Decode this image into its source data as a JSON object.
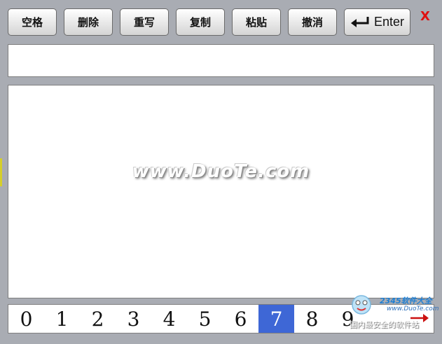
{
  "toolbar": {
    "space_label": "空格",
    "delete_label": "删除",
    "rewrite_label": "重写",
    "copy_label": "复制",
    "paste_label": "粘贴",
    "undo_label": "撤消",
    "enter_label": "Enter",
    "close_label": "X"
  },
  "input": {
    "value": ""
  },
  "handwriting": {
    "watermark": "www.DuoTe.com"
  },
  "digits": {
    "items": [
      "0",
      "1",
      "2",
      "3",
      "4",
      "5",
      "6",
      "7",
      "8",
      "9"
    ],
    "selected": "7"
  },
  "logo": {
    "brand": "2345软件大全",
    "url": "www.DuoTe.com",
    "tagline": "国内最安全的软件站"
  },
  "colors": {
    "selected_digit": "#3e67d6",
    "close": "#e01010",
    "arrow": "#cc1111"
  },
  "icons": [
    "enter-return-icon",
    "close-icon",
    "right-arrow-icon"
  ]
}
